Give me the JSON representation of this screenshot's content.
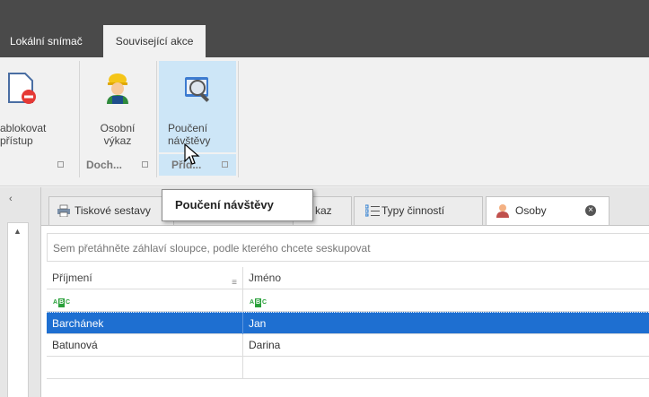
{
  "ribbon": {
    "tabs": [
      "Lokální snímač",
      "Související akce"
    ],
    "active_tab": "Související akce",
    "buttons": {
      "block_access": {
        "label": "ablokovat\npřístup",
        "icon": "block-document-icon"
      },
      "personal_report": {
        "label": "Osobní\nvýkaz",
        "icon": "worker-icon"
      },
      "visit_instruction": {
        "label": "Poučení\nnávštěvy",
        "icon": "visit-instruction-icon"
      }
    },
    "groups": [
      "Doch...",
      "Přid..."
    ]
  },
  "tooltip": {
    "text": "Poučení návštěvy"
  },
  "doc_tabs": [
    {
      "label": "Tiskové sestavy",
      "icon": "printer-icon"
    },
    {
      "label": "kaz",
      "icon": ""
    },
    {
      "label": "Typy činností",
      "icon": "list-icon"
    },
    {
      "label": "Osoby",
      "icon": "person-icon",
      "active": true
    }
  ],
  "grid": {
    "group_panel_text": "Sem přetáhněte záhlaví sloupce, podle kterého chcete seskupovat",
    "columns": [
      "Příjmení",
      "Jméno"
    ],
    "filter_icon": "abc-filter-icon",
    "rows": [
      {
        "surname": "Barchánek",
        "name": "Jan",
        "selected": true
      },
      {
        "surname": "Batunová",
        "name": "Darina",
        "selected": false
      }
    ]
  },
  "colors": {
    "selection": "#1e6fd1",
    "hover": "#cde6f7",
    "titlebar": "#4a4a4a"
  }
}
